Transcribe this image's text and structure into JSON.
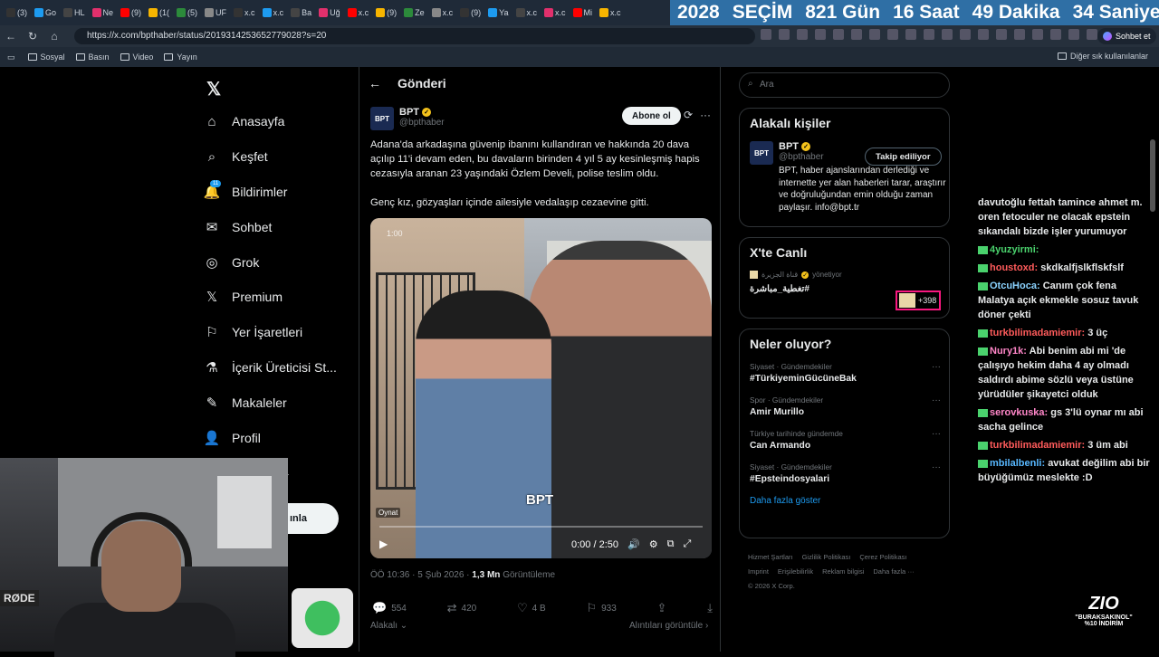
{
  "browser": {
    "tabs": [
      "(3)",
      "Go",
      "HL",
      "Ne",
      "(9)",
      "(1(",
      "(5)",
      "UF",
      "x.c",
      "x.c",
      "Ba",
      "Uğ",
      "x.c",
      "(9)",
      "Ze",
      "x.c",
      "(9)",
      "Ya",
      "x.c",
      "x.c",
      "Mi",
      "x.c"
    ],
    "url": "https://x.com/bpthaber/status/2019314253652779028?s=20",
    "sohbet_label": "Sohbet et",
    "bookmarks": [
      "Sosyal",
      "Basın",
      "Video",
      "Yayın"
    ],
    "bookmarks_more": "Diğer sık kullanılanlar"
  },
  "countdown": {
    "year": "2028",
    "title": "SEÇİM",
    "days": "821 Gün",
    "hours": "16 Saat",
    "minutes": "49 Dakika",
    "seconds": "34 Saniye"
  },
  "sidebar": {
    "items": [
      {
        "label": "Anasayfa",
        "icon": "home-icon"
      },
      {
        "label": "Keşfet",
        "icon": "search-icon"
      },
      {
        "label": "Bildirimler",
        "icon": "bell-icon",
        "badge": "11"
      },
      {
        "label": "Sohbet",
        "icon": "mail-icon"
      },
      {
        "label": "Grok",
        "icon": "grok-icon"
      },
      {
        "label": "Premium",
        "icon": "x-icon"
      },
      {
        "label": "Yer İşaretleri",
        "icon": "bookmark-icon"
      },
      {
        "label": "İçerik Üreticisi St...",
        "icon": "flask-icon"
      },
      {
        "label": "Makaleler",
        "icon": "article-icon"
      },
      {
        "label": "Profil",
        "icon": "user-icon"
      }
    ],
    "more_fragment": "a",
    "post_button_fragment": "ınla"
  },
  "post": {
    "header": "Gönderi",
    "author_name": "BPT",
    "author_handle": "@bpthaber",
    "avatar_text": "BPT",
    "follow_label": "Abone ol",
    "text_p1": "Adana'da arkadaşına güvenip ibanını kullandıran ve hakkında 20 dava açılıp 11'i devam eden, bu davaların birinden 4 yıl 5 ay kesinleşmiş hapis cezasıyla aranan 23 yaşındaki Özlem Develi, polise teslim oldu.",
    "text_p2": "Genç kız, gözyaşları içinde ailesiyle vedalaşıp cezaevine gitti.",
    "video": {
      "overlay_time": "1:00",
      "watermark": "BPT",
      "play_tooltip": "Oynat",
      "time": "0:00 / 2:50",
      "progress": 0
    },
    "timestamp": "ÖÖ 10:36 · 5 Şub 2026 · ",
    "views_value": "1,3 Mn",
    "views_label": " Görüntüleme",
    "stats": {
      "replies": "554",
      "reposts": "420",
      "likes": "4 B",
      "bookmarks": "933"
    },
    "related": "Alakalı",
    "quotes": "Alıntıları görüntüle"
  },
  "right": {
    "search_placeholder": "Ara",
    "related_people": {
      "title": "Alakalı kişiler",
      "name": "BPT",
      "handle": "@bpthaber",
      "follow": "Takip ediliyor",
      "bio": "BPT, haber ajanslarından derlediği ve internette yer alan haberleri tarar, araştırır ve doğruluğundan emin olduğu zaman paylaşır. info@bpt.tr"
    },
    "live": {
      "title": "X'te Canlı",
      "channel": "قناة الجزيرة",
      "manages": "yönetiyor",
      "topic": "تغطية_مباشرة#",
      "count": "+398"
    },
    "trends": {
      "title": "Neler oluyor?",
      "items": [
        {
          "cat": "Siyaset · Gündemdekiler",
          "name": "#TürkiyeminGücüneBak"
        },
        {
          "cat": "Spor · Gündemdekiler",
          "name": "Amir Murillo"
        },
        {
          "cat": "Türkiye tarihinde gündemde",
          "name": "Can Armando"
        },
        {
          "cat": "Siyaset · Gündemdekiler",
          "name": "#Epsteindosyalari"
        }
      ],
      "show_more": "Daha fazla göster"
    },
    "footer": {
      "links": [
        "Hizmet Şartları",
        "Gizlilik Politikası",
        "Çerez Politikası",
        "Imprint",
        "Erişilebilirlik",
        "Reklam bilgisi",
        "Daha fazla ···"
      ],
      "copyright": "© 2026 X Corp."
    }
  },
  "chat": {
    "messages": [
      {
        "user": "",
        "text": "davutoğlu fettah tamince ahmet m. oren fetoculer ne olacak epstein sıkandalı bizde işler yurumuyor"
      },
      {
        "user": "4yuzyirmi:",
        "text": "",
        "color": "u-green"
      },
      {
        "user": "houstoxd:",
        "text": "skdkalfjslkflskfslf",
        "color": "u-red"
      },
      {
        "user": "OtcuHoca:",
        "text": "Canım çok fena Malatya açık ekmekle sosuz tavuk döner çekti",
        "color": "u-cyan"
      },
      {
        "user": "turkbilimadamiemir:",
        "text": "3 üç",
        "color": "u-red"
      },
      {
        "user": "Nury1k:",
        "text": "Abi benim abi mi 'de çalışıyo hekim daha 4 ay olmadı saldırdı abime sözlü veya üstüne yürüdüler şikayetci olduk",
        "color": "u-pink"
      },
      {
        "user": "serovkuska:",
        "text": "gs 3'lü oynar mı abi sacha gelince",
        "color": "u-pink"
      },
      {
        "user": "turkbilimadamiemir:",
        "text": "3 üm abi",
        "color": "u-red"
      },
      {
        "user": "mbilalbenli:",
        "text": "avukat değilim abi bir büyüğümüz meslekte :D",
        "color": "u-blue"
      }
    ]
  },
  "overlay": {
    "mic_brand": "RØDE",
    "promo_logo": "ZIO",
    "promo_code": "\"BURAKSAKINOL\"",
    "promo_discount": "%10 İNDİRİM"
  },
  "colors": {
    "accent": "#1d9bf0",
    "background": "#000000",
    "border": "#2f3336",
    "countdown_bg": "#2f6fa5"
  }
}
